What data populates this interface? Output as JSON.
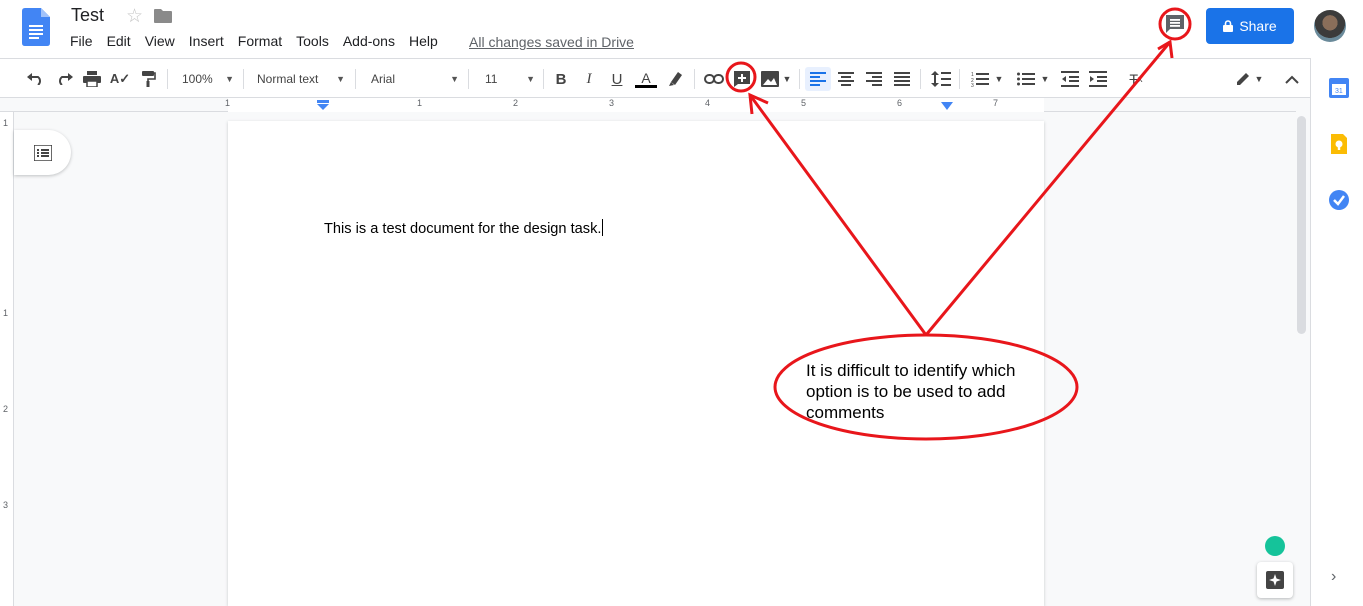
{
  "header": {
    "title": "Test",
    "menu": [
      "File",
      "Edit",
      "View",
      "Insert",
      "Format",
      "Tools",
      "Add-ons",
      "Help"
    ],
    "saved_status": "All changes saved in Drive",
    "share_label": "Share"
  },
  "toolbar": {
    "zoom": "100%",
    "style": "Normal text",
    "font": "Arial",
    "size": "11"
  },
  "ruler": {
    "h_labels": [
      "1",
      "1",
      "2",
      "3",
      "4",
      "5",
      "6",
      "7"
    ],
    "v_labels": [
      "1",
      "1",
      "2",
      "3"
    ]
  },
  "document": {
    "body_text": "This is a test document for the design task."
  },
  "annotation": {
    "text": "It is difficult to identify which option is to be used to add comments",
    "color": "#e8161b"
  },
  "colors": {
    "accent": "#1a73e8",
    "text_color_bar": "#000000"
  }
}
